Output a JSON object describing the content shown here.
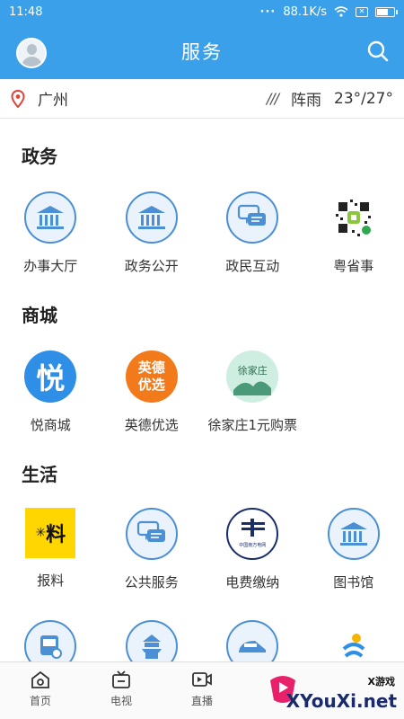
{
  "status": {
    "time": "11:48",
    "speed": "88.1K/s"
  },
  "header": {
    "title": "服务"
  },
  "location": {
    "city": "广州",
    "weather": "阵雨",
    "temp": "23°/27°"
  },
  "sections": [
    {
      "title": "政务",
      "items": [
        {
          "label": "办事大厅",
          "icon": "bank-icon"
        },
        {
          "label": "政务公开",
          "icon": "bank-icon"
        },
        {
          "label": "政民互动",
          "icon": "chat-icon"
        },
        {
          "label": "粤省事",
          "icon": "qr-code-icon"
        }
      ]
    },
    {
      "title": "商城",
      "items": [
        {
          "label": "悦商城",
          "icon": "yue-logo-icon",
          "glyph": "悦"
        },
        {
          "label": "英德优选",
          "icon": "yingde-logo-icon",
          "glyph": "英德\n优选"
        },
        {
          "label": "徐家庄1元购票",
          "icon": "xujiazhuang-logo-icon",
          "glyph": "徐家庄"
        }
      ]
    },
    {
      "title": "生活",
      "items": [
        {
          "label": "报料",
          "icon": "baoliao-logo-icon",
          "glyph": "料"
        },
        {
          "label": "公共服务",
          "icon": "chat-icon"
        },
        {
          "label": "电费缴纳",
          "icon": "power-grid-icon",
          "glyph": "中国南方电网"
        },
        {
          "label": "图书馆",
          "icon": "bank-icon"
        }
      ]
    }
  ],
  "nav": [
    {
      "label": "首页",
      "icon": "home-icon"
    },
    {
      "label": "电视",
      "icon": "tv-icon"
    },
    {
      "label": "直播",
      "icon": "video-icon"
    },
    {
      "label": "",
      "icon": "play-icon"
    },
    {
      "label": "",
      "icon": "user-icon"
    }
  ],
  "watermark": {
    "brand": "XYouXi.net",
    "tag": "X游戏"
  }
}
